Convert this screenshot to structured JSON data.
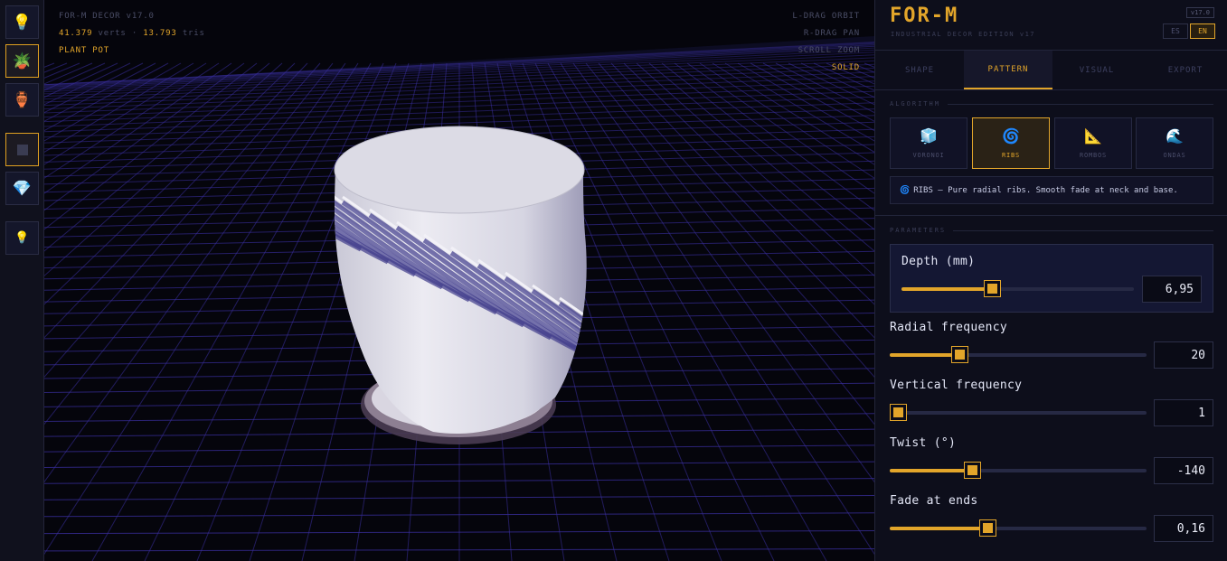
{
  "toolbar": {
    "items": [
      {
        "icon": "lightbulb-icon",
        "glyph": "💡"
      },
      {
        "icon": "plant-pot-icon",
        "glyph": "🪴"
      },
      {
        "icon": "vase-icon",
        "glyph": "🏺"
      },
      {
        "icon": "square-icon",
        "glyph": ""
      },
      {
        "icon": "gem-icon",
        "glyph": "💎"
      },
      {
        "icon": "lightbulb-icon",
        "glyph": "💡"
      }
    ]
  },
  "hud": {
    "title": "FOR-M DECOR v17.0",
    "verts_value": "41.379",
    "verts_label": "verts",
    "tris_value": "13.793",
    "tris_label": "tris",
    "model": "PLANT POT",
    "hint_orbit": "L-DRAG ORBIT",
    "hint_pan": "R-DRAG PAN",
    "hint_zoom": "SCROLL ZOOM",
    "render_mode": "SOLID"
  },
  "panel": {
    "brand": "FOR-M",
    "subtitle": "INDUSTRIAL DECOR EDITION v17",
    "version": "v17.0",
    "lang_es": "ES",
    "lang_en": "EN",
    "tabs": [
      "SHAPE",
      "PATTERN",
      "VISUAL",
      "EXPORT"
    ],
    "active_tab": "PATTERN",
    "algorithm_label": "ALGORITHM",
    "algorithms": [
      {
        "label": "VORONOI",
        "glyph": "🧊"
      },
      {
        "label": "RIBS",
        "glyph": "🌀"
      },
      {
        "label": "ROMBOS",
        "glyph": "📐"
      },
      {
        "label": "ONDAS",
        "glyph": "🌊"
      }
    ],
    "active_algorithm": "RIBS",
    "description_glyph": "🌀",
    "description": "RIBS — Pure radial ribs. Smooth fade at neck and base.",
    "parameters_label": "PARAMETERS",
    "params": [
      {
        "label": "Depth (mm)",
        "value": "6,95",
        "fraction": 0.39
      },
      {
        "label": "Radial frequency",
        "value": "20",
        "fraction": 0.27
      },
      {
        "label": "Vertical frequency",
        "value": "1",
        "fraction": 0.03
      },
      {
        "label": "Twist (°)",
        "value": "-140",
        "fraction": 0.32
      },
      {
        "label": "Fade at ends",
        "value": "0,16",
        "fraction": 0.38
      }
    ]
  },
  "colors": {
    "accent": "#e2a52a",
    "grid": "#3a2fa0",
    "background": "#05050c"
  }
}
